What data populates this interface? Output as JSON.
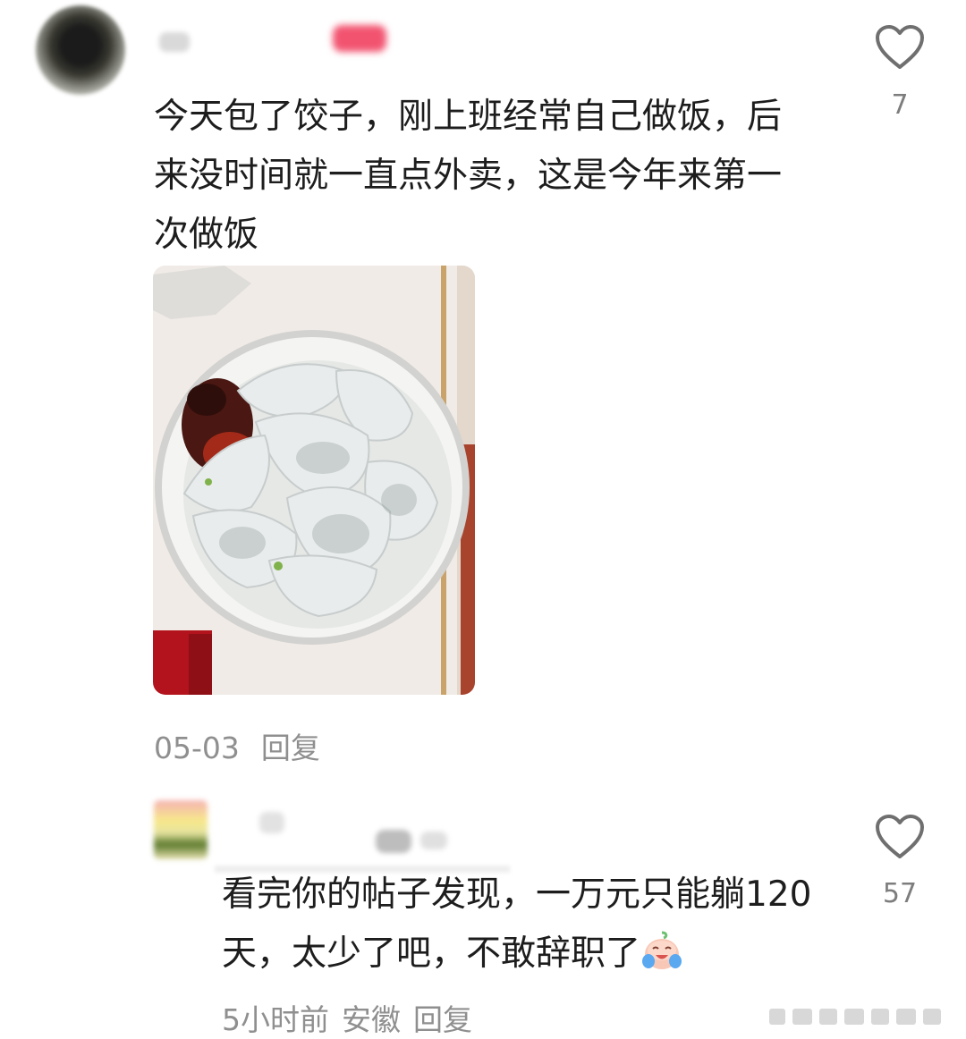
{
  "comments": [
    {
      "text": "今天包了饺子，刚上班经常自己做饭，后来没时间就一直点外卖，这是今年来第一次做饭",
      "date": "05-03",
      "reply_label": "回复",
      "likes": "7",
      "image": {
        "icon": "dumplings-photo"
      }
    },
    {
      "text": "看完你的帖子发现，一万元只能躺120天，太少了吧，不敢辞职了",
      "emoji": "crying-laughing-face-icon",
      "time": "5小时前",
      "location": "安徽",
      "reply_label": "回复",
      "likes": "57"
    }
  ],
  "colors": {
    "text": "#1d1d1d",
    "meta": "#8f8f8f",
    "icon": "#6f6f6f"
  }
}
